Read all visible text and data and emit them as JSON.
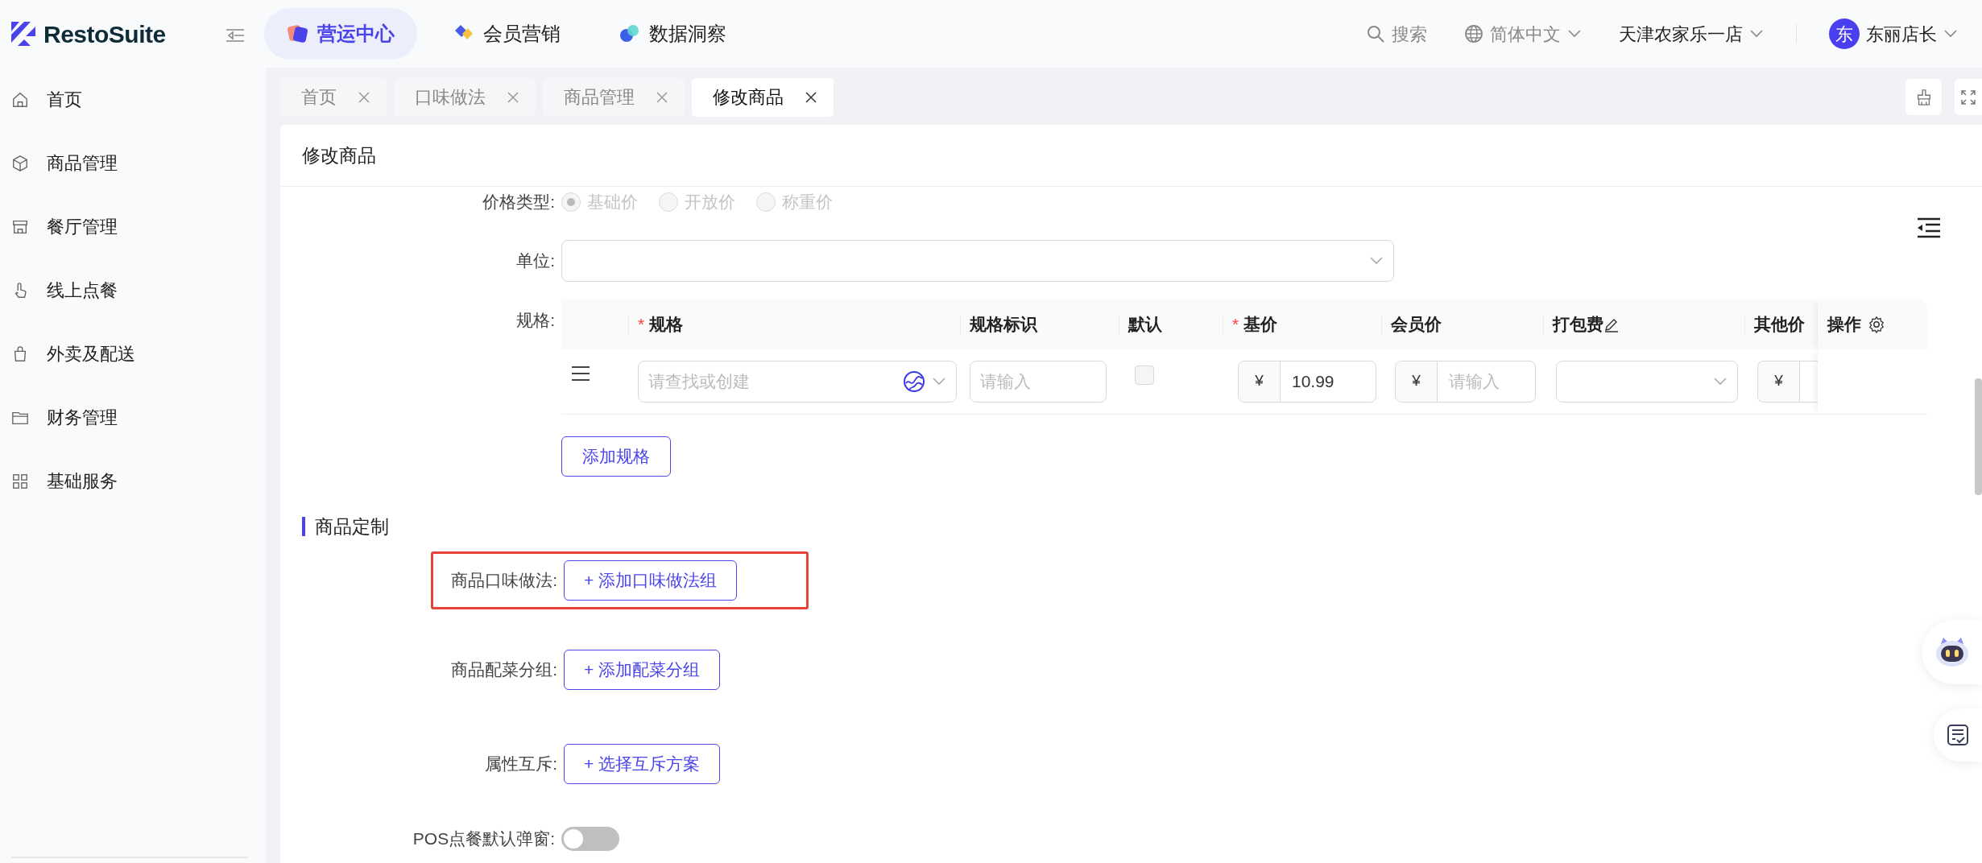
{
  "brand": {
    "name": "RestoSuite"
  },
  "top_nav": [
    {
      "label": "营运中心",
      "selected": true
    },
    {
      "label": "会员营销",
      "selected": false
    },
    {
      "label": "数据洞察",
      "selected": false
    }
  ],
  "header_tools": {
    "search": "搜索",
    "language": "简体中文",
    "store": "天津农家乐一店",
    "avatar": "东",
    "user": "东丽店长"
  },
  "sidebar": {
    "items": [
      {
        "label": "首页"
      },
      {
        "label": "商品管理"
      },
      {
        "label": "餐厅管理"
      },
      {
        "label": "线上点餐"
      },
      {
        "label": "外卖及配送"
      },
      {
        "label": "财务管理"
      },
      {
        "label": "基础服务"
      }
    ]
  },
  "tabs": [
    {
      "label": "首页",
      "selected": false
    },
    {
      "label": "口味做法",
      "selected": false
    },
    {
      "label": "商品管理",
      "selected": false
    },
    {
      "label": "修改商品",
      "selected": true
    }
  ],
  "page_title": "修改商品",
  "price_type": {
    "label": "价格类型:",
    "disabled": true,
    "options": [
      {
        "label": "基础价",
        "selected": true
      },
      {
        "label": "开放价",
        "selected": false
      },
      {
        "label": "称重价",
        "selected": false
      }
    ]
  },
  "unit": {
    "label": "单位:"
  },
  "specs": {
    "label": "规格:",
    "columns": [
      {
        "label": "规格",
        "required_mark": "*"
      },
      {
        "label": "规格标识"
      },
      {
        "label": "默认"
      },
      {
        "label": "基价",
        "required_mark": "*"
      },
      {
        "label": "会员价"
      },
      {
        "label": "打包费",
        "editable": true
      },
      {
        "label": "其他价"
      }
    ],
    "fixed_column": "操作",
    "rows": [
      {
        "spec_placeholder": "请查找或创建",
        "tag_placeholder": "请输入",
        "checked": false,
        "base_currency": "¥",
        "base_price": "10.99",
        "member_currency": "¥",
        "member_placeholder": "请输入",
        "other_currency": "¥"
      }
    ],
    "add_button": "添加规格"
  },
  "customization": {
    "title": "商品定制",
    "rows": [
      {
        "label": "商品口味做法:",
        "button": "+ 添加口味做法组",
        "highlighted": true
      },
      {
        "label": "商品配菜分组:",
        "button": "+ 添加配菜分组",
        "highlighted": false
      },
      {
        "label": "属性互斥:",
        "button": "+ 选择互斥方案",
        "highlighted": false
      }
    ]
  },
  "pos_popup": {
    "label": "POS点餐默认弹窗:",
    "on": false
  }
}
